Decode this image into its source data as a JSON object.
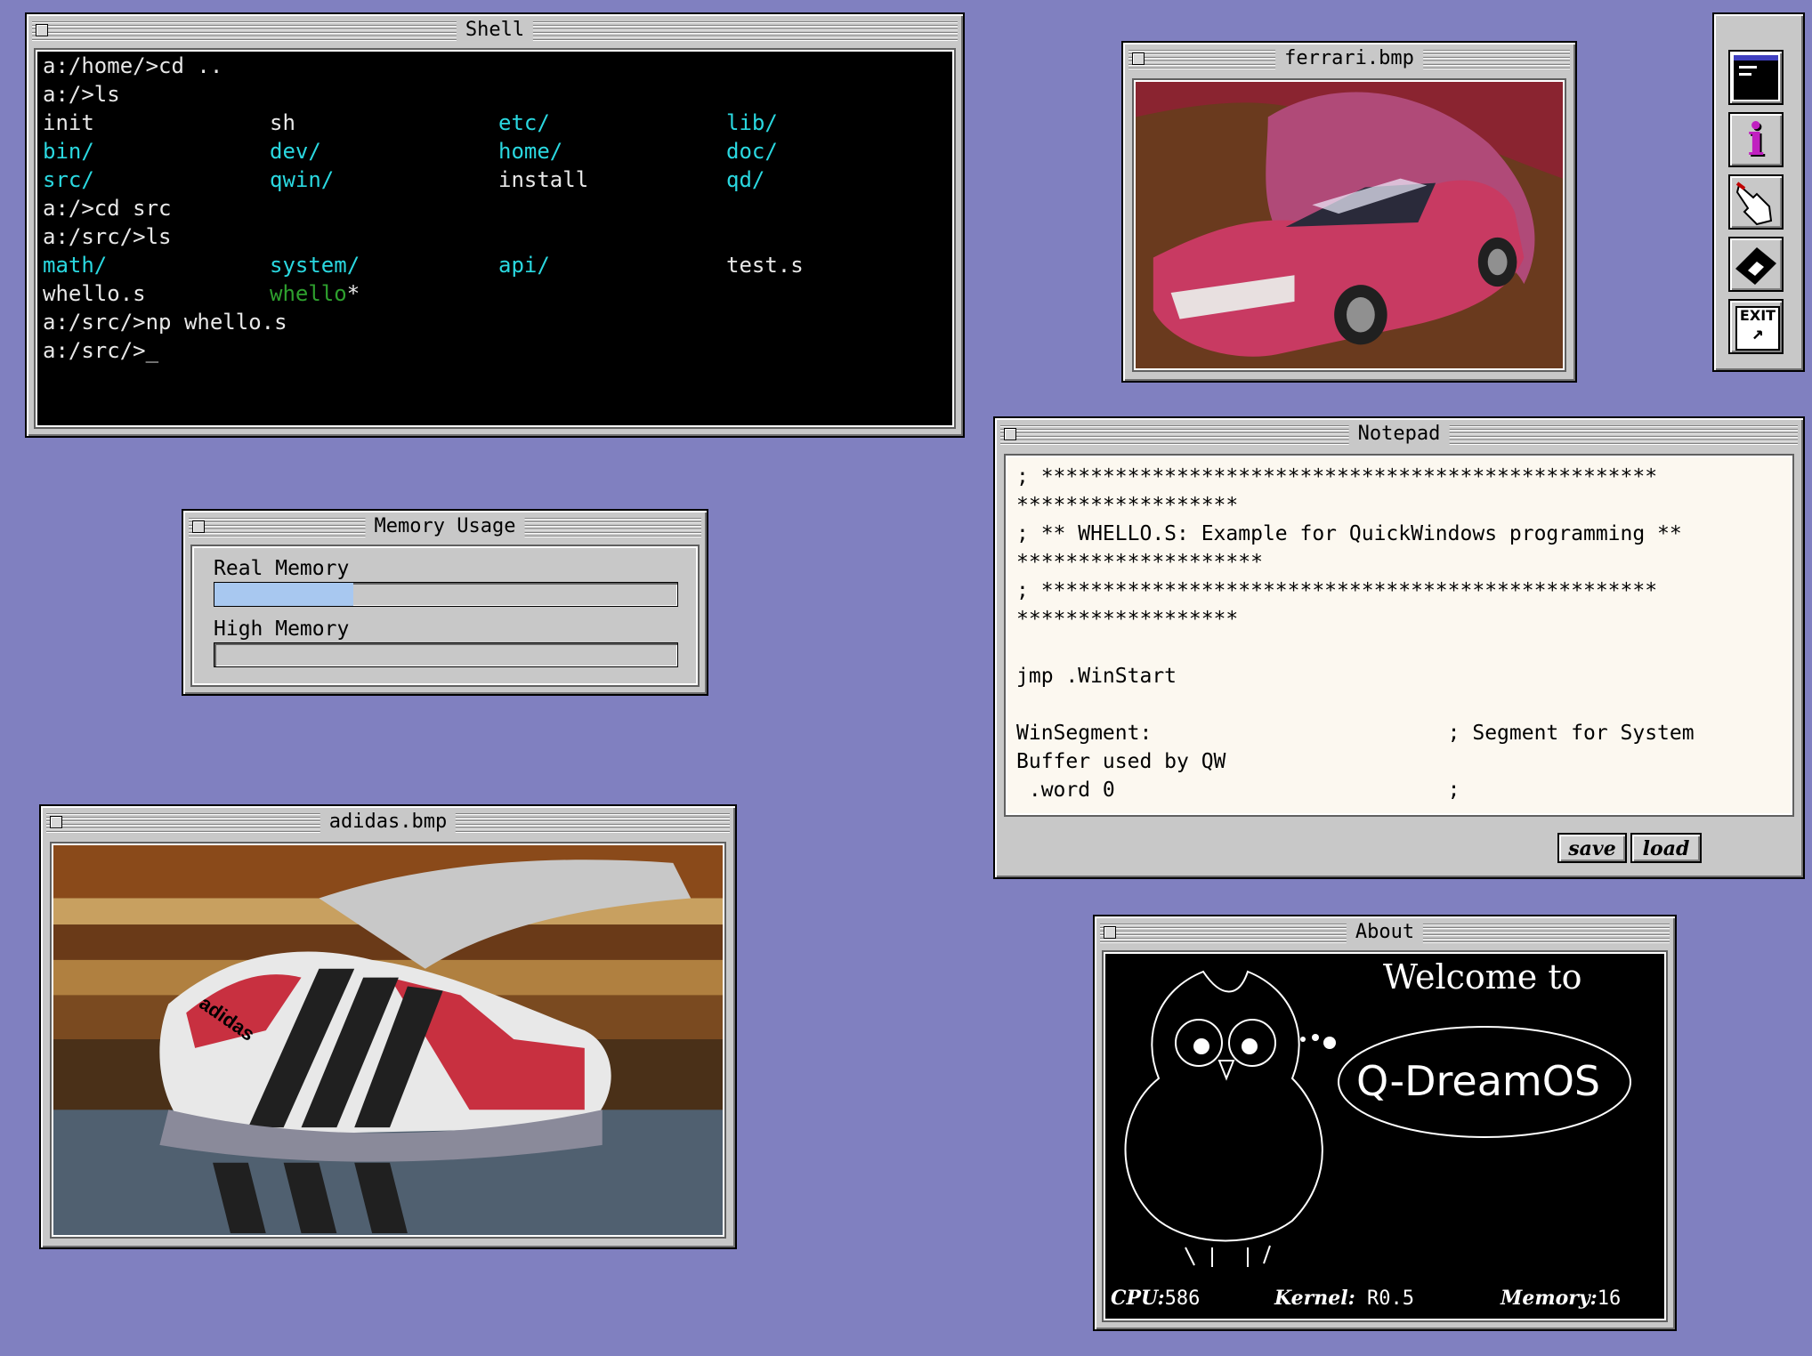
{
  "shell": {
    "title": "Shell",
    "lines": [
      [
        "a:/home/>cd .."
      ],
      [
        "a:/>ls"
      ],
      [
        "init",
        "sh",
        "etc/",
        "lib/"
      ],
      [
        "bin/",
        "dev/",
        "home/",
        "doc/"
      ],
      [
        "src/",
        "qwin/",
        "install",
        "qd/"
      ],
      [
        "a:/>cd src"
      ],
      [
        "a:/src/>ls"
      ],
      [
        "math/",
        "system/",
        "api/",
        "test.s"
      ],
      [
        "whello.s",
        "whello",
        "",
        ""
      ],
      [
        "a:/src/>np whello.s"
      ],
      [
        "a:/src/>_"
      ]
    ],
    "exec_mark": "*"
  },
  "ferrari": {
    "title": "ferrari.bmp"
  },
  "memory": {
    "title": "Memory Usage",
    "real_label": "Real Memory",
    "high_label": "High Memory",
    "real_fraction": 0.3,
    "high_fraction": 0.0
  },
  "adidas": {
    "title": "adidas.bmp",
    "brand": "adidas"
  },
  "notepad": {
    "title": "Notepad",
    "lines": [
      "; **************************************************",
      "******************",
      "; ** WHELLO.S: Example for QuickWindows programming **",
      "********************",
      "; **************************************************",
      "******************",
      "",
      "jmp .WinStart",
      "",
      "WinSegment:                        ; Segment for System",
      "Buffer used by QW",
      " .word 0                           ;"
    ],
    "save_label": "save",
    "load_label": "load"
  },
  "about": {
    "title": "About",
    "welcome": "Welcome to",
    "product": "Q-DreamOS",
    "cpu_label": "CPU:",
    "cpu_value": "586",
    "kernel_label": "Kernel:",
    "kernel_value": "R0.5",
    "memory_label": "Memory:",
    "memory_value": "16"
  },
  "toolbar": {
    "items": [
      "shell-icon",
      "info-icon",
      "hand-pointer-icon",
      "memory-chip-icon",
      "exit-icon"
    ],
    "exit_label": "EXIT",
    "info_glyph": "i"
  }
}
